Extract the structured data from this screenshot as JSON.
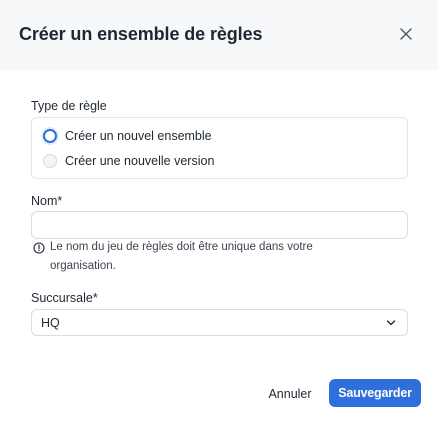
{
  "dialog": {
    "title": "Créer un ensemble de règles",
    "close_icon": "close-icon"
  },
  "rule_type": {
    "label": "Type de règle",
    "options": [
      {
        "label": "Créer un nouvel ensemble",
        "checked": true
      },
      {
        "label": "Créer une nouvelle version",
        "checked": false
      }
    ]
  },
  "name_field": {
    "label": "Nom",
    "required_marker": "*",
    "value": "",
    "hint_icon": "info-icon",
    "hint": "Le nom du jeu de règles doit être unique dans votre organisation."
  },
  "branch_field": {
    "label": "Succursale",
    "required_marker": "*",
    "value": "HQ",
    "chevron_icon": "chevron-down-icon"
  },
  "actions": {
    "cancel_label": "Annuler",
    "save_label": "Sauvegarder"
  },
  "colors": {
    "accent": "#2f6fdc",
    "header_bg": "#f7f8f9"
  }
}
